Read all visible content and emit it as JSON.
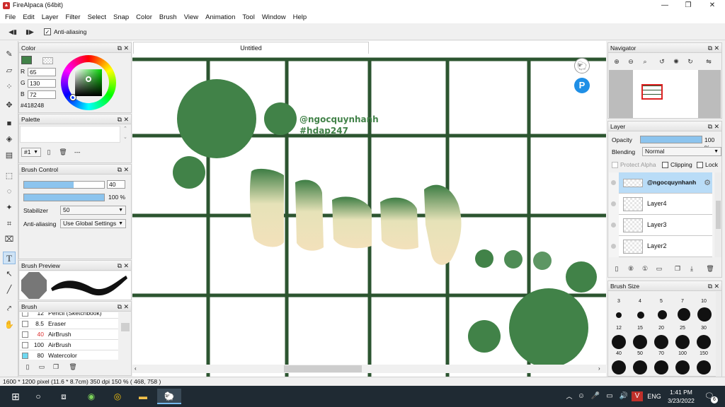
{
  "window": {
    "title": "FireAlpaca (64bit)",
    "minimize": "—",
    "maximize": "❐",
    "close": "✕"
  },
  "menu": [
    "File",
    "Edit",
    "Layer",
    "Filter",
    "Select",
    "Snap",
    "Color",
    "Brush",
    "View",
    "Animation",
    "Tool",
    "Window",
    "Help"
  ],
  "tool_options": {
    "anti_aliasing_label": "Anti-aliasing",
    "anti_aliasing_checked": true
  },
  "panels": {
    "color": {
      "title": "Color",
      "r_label": "R",
      "g_label": "G",
      "b_label": "B",
      "r": "65",
      "g": "130",
      "b": "72",
      "hex": "#418248",
      "current_color": "#418248"
    },
    "palette": {
      "title": "Palette",
      "selector": "#1",
      "name": "---"
    },
    "brush_control": {
      "title": "Brush Control",
      "size_value": "40",
      "size_fraction": 0.62,
      "opacity_value": "100 %",
      "opacity_fraction": 1.0,
      "stabilizer_label": "Stabilizer",
      "stabilizer_value": "50",
      "anti_aliasing_label": "Anti-aliasing",
      "anti_aliasing_value": "Use Global Settings"
    },
    "brush_preview": {
      "title": "Brush Preview"
    },
    "brush": {
      "title": "Brush",
      "items": [
        {
          "size": "12",
          "name": "Pencil (Sketchbook)",
          "color": "#ffffff"
        },
        {
          "size": "8.5",
          "name": "Eraser",
          "color": "#ffffff"
        },
        {
          "size": "40",
          "name": "AirBrush",
          "color": "#ffffff"
        },
        {
          "size": "100",
          "name": "AirBrush",
          "color": "#ffffff"
        },
        {
          "size": "80",
          "name": "Watercolor",
          "color": "#6fd8f0"
        }
      ]
    },
    "navigator": {
      "title": "Navigator"
    },
    "layer": {
      "title": "Layer",
      "opacity_label": "Opacity",
      "opacity_value": "100 %",
      "opacity_fraction": 1.0,
      "blending_label": "Blending",
      "blending_value": "Normal",
      "protect_alpha": "Protect Alpha",
      "clipping": "Clipping",
      "lock": "Lock",
      "layers": [
        {
          "name": "@ngocquynhanh",
          "selected": true
        },
        {
          "name": "Layer4",
          "selected": false
        },
        {
          "name": "Layer3",
          "selected": false
        },
        {
          "name": "Layer2",
          "selected": false
        }
      ]
    },
    "brush_size": {
      "title": "Brush Size",
      "rows": [
        [
          "3",
          "4",
          "5",
          "7",
          "10"
        ],
        [
          "12",
          "15",
          "20",
          "25",
          "30"
        ],
        [
          "40",
          "50",
          "70",
          "100",
          "150"
        ]
      ]
    }
  },
  "document": {
    "tab_title": "Untitled",
    "watermark_line1": "@ngocquynhanh",
    "watermark_line2": "#hdap247",
    "ink_color": "#418248",
    "grid_color": "#2c5530"
  },
  "status": {
    "text": "1600 * 1200 pixel   (11.6 * 8.7cm)   350 dpi   150 %   ( 468, 758 )"
  },
  "taskbar": {
    "time": "1:41 PM",
    "date": "3/23/2022",
    "lang": "ENG",
    "notif": "6"
  }
}
